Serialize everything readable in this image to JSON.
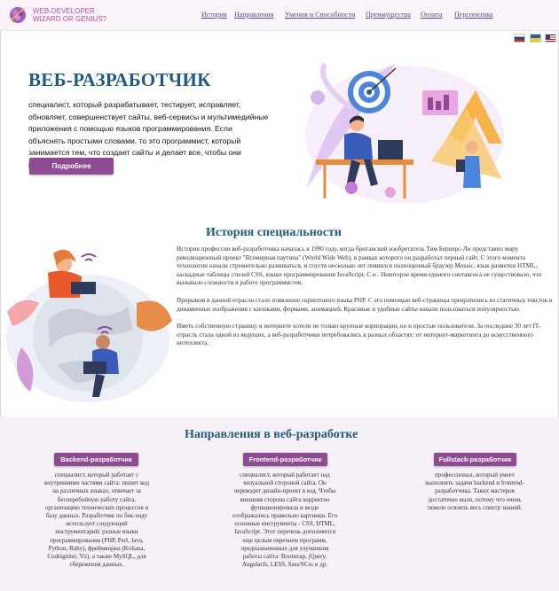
{
  "header": {
    "logo_line1": "WEB-DEVELOPER",
    "logo_line2": "WIZARD OR GENIUS?",
    "nav": [
      "История",
      "Направления",
      "Умения и Способности",
      "Преимущества",
      "Оплата",
      "Перспектива"
    ]
  },
  "flags": [
    {
      "name": "russia-flag-icon",
      "colors": [
        "#ffffff",
        "#1c3fa0",
        "#d52b1e"
      ]
    },
    {
      "name": "ukraine-flag-icon",
      "colors": [
        "#1f5fbf",
        "#f5d000"
      ]
    },
    {
      "name": "usa-flag-icon",
      "colors": [
        "#b22234",
        "#ffffff",
        "#3c3b6e"
      ]
    }
  ],
  "hero": {
    "title": "ВЕБ-РАЗРАБОТЧИК",
    "description": "специалист, который разрабатывает, тестирует, исправляет, обновляет, совершенствует сайты, веб-сервисы и мультимедийные приложения с помощью языков программирования. Если объяснять простыми словами, то это программист, который занимается тем, что создает сайты и делает все, чтобы они правильно работали.",
    "button": "Подробнее"
  },
  "history": {
    "title": "История специальности",
    "paragraphs": [
      "История профессии веб-разработчика началась в 1990 году, когда британский изобретатель Тим Бернерс-Ли представил миру революционный проект \"Всемирная паутина\" (World Wide Web), в рамках которого он разработал первый сайт. С этого момента технологии начали стремительно развиваться, и спустя несколько лет появился полноценный браузер Mosaic, язык разметки HTML, каскадные таблицы стилей CSS, языки программирования JavaScript, C и . Некоторое время единого синтаксиса не существовало, что вызывало сложности в работе программистов.",
      "Прорывом в данной отрасли стало появление скриптового языка PHP. С его помощью веб-страницы превратились из статичных текстов в динамичные изображения с кнопками, формами, анимацией. Красивые и удобные сайты начали пользоваться популярностью.",
      "Иметь собственную страницу в интернете хотели не только крупные корпорации, но и простые пользователи. За последние 30 лет IT-отрасль стала одной из ведущих, а веб-разработчики потребовались в разных областях: от интернет-маркетинга до искусственного интеллекта."
    ]
  },
  "directions": {
    "title": "Направления в веб-разработке",
    "cards": [
      {
        "button": "Backend-разработчик",
        "text": "специалист, который работает с внутренними частями сайта: пишет код на различных языках, отвечает за бесперебойную работу сайта, организацию технических процессов и базу данных. Разработчик по бек-энду использует следующий инструментарий: разные языки программирования (PHP, Perl, Java, Python, Ruby), фреймворки (Kohana, Codeigniter, Yii), а также MySQL, для сбережения данных."
      },
      {
        "button": "Frontend-разработчик",
        "text": "специалист, который работает над визуальной стороной сайта. Он переводит дизайн-проект в код. Чтобы внешняя сторона сайта корректно функционировала и везде отображались правильно картинки. Его основные инструменты - CSS, HTML, JavaScript. Этот перечень дополняется еще целым перечнем программ, предназначенных для улучшения работы сайта: Bootstrap, jQuery, AngularJs, LESS, Sass/SCss и др."
      },
      {
        "button": "Fullstack-разработчик",
        "text": "профессионал, который умеет выполнять задачи backend и frontend-разработчика. Таких мастеров достаточно мало, потому что очень тяжело освоить весь спектр знаний."
      }
    ]
  },
  "colors": {
    "accent": "#8e4a93",
    "title": "#1f5a87",
    "nav": "#5a4aa8",
    "logo": "#c04fa0"
  }
}
